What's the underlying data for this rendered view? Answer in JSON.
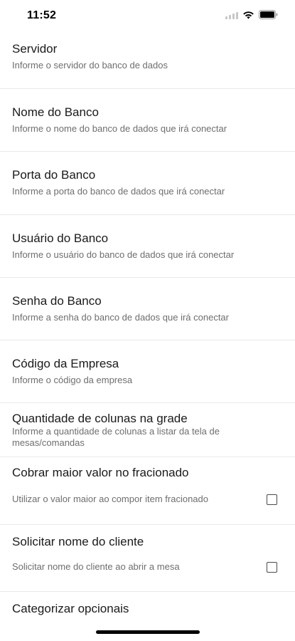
{
  "status": {
    "time": "11:52"
  },
  "settings": [
    {
      "title": "Servidor",
      "subtitle": "Informe o servidor do banco de dados"
    },
    {
      "title": "Nome do Banco",
      "subtitle": "Informe o nome do banco de dados que irá conectar"
    },
    {
      "title": "Porta do Banco",
      "subtitle": "Informe a porta do banco de dados que irá conectar"
    },
    {
      "title": "Usuário do Banco",
      "subtitle": "Informe o usuário do banco de dados que irá conectar"
    },
    {
      "title": "Senha do Banco",
      "subtitle": "Informe a senha do banco de dados que irá conectar"
    },
    {
      "title": "Código da Empresa",
      "subtitle": "Informe o código da empresa"
    },
    {
      "title": "Quantidade de colunas na grade",
      "subtitle": "Informe a quantidade de colunas a listar da tela de mesas/comandas"
    },
    {
      "title": "Cobrar maior valor no fracionado",
      "subtitle": "Utilizar o valor maior ao compor item fracionado",
      "checked": false
    },
    {
      "title": "Solicitar nome do cliente",
      "subtitle": "Solicitar nome do cliente ao abrir a mesa",
      "checked": false
    },
    {
      "title": "Categorizar opcionais"
    }
  ]
}
